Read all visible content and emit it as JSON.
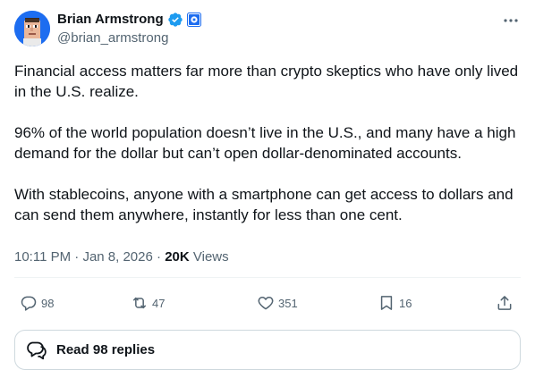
{
  "author": {
    "display_name": "Brian Armstrong",
    "handle": "@brian_armstrong",
    "verified": true,
    "avatar_icon": "pixel-avatar-icon",
    "affiliation_icon": "coinbase-affiliate-icon"
  },
  "post": {
    "paragraphs": [
      "Financial access matters far more than crypto skeptics who have only lived in the U.S. realize.",
      "96% of the world population doesn’t live in the U.S., and many have a high demand for the dollar but can’t open dollar-denominated accounts.",
      "With stablecoins, anyone with a smartphone can get access to dollars and can send them anywhere, instantly for less than one cent."
    ]
  },
  "meta": {
    "time": "10:11 PM",
    "sep1": "·",
    "date": "Jan 8, 2026",
    "sep2": "·",
    "views_count": "20K",
    "views_label": "Views"
  },
  "actions": {
    "replies": "98",
    "reposts": "47",
    "likes": "351",
    "bookmarks": "16"
  },
  "replies_box": {
    "label": "Read 98 replies"
  },
  "colors": {
    "text": "#0f1419",
    "secondary": "#536471",
    "verified_blue": "#1d9bf0",
    "avatar_bg": "#1d6df0",
    "border": "#cfd9de"
  }
}
